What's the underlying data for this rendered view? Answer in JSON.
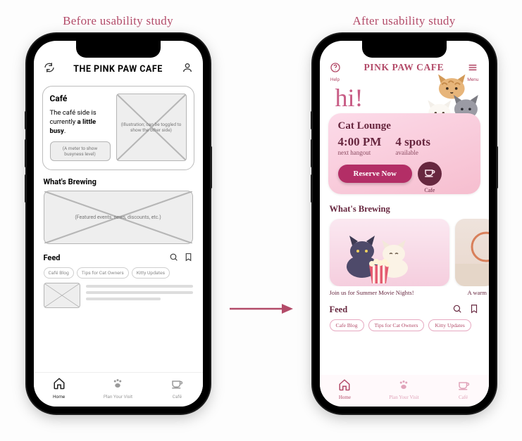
{
  "captions": {
    "before": "Before usability study",
    "after": "After usability study"
  },
  "before": {
    "title": "THE PINK PAW CAFE",
    "card": {
      "heading": "Café",
      "status_prefix": "The café side is currently ",
      "status_bold": "a little busy",
      "status_suffix": ".",
      "meter_placeholder": "(A meter to show busyness level)",
      "illustration_placeholder": "(Illustration; can be toggled to show the other side)"
    },
    "brewing": {
      "heading": "What's Brewing",
      "placeholder": "(Featured events, news, discounts, etc.)"
    },
    "feed": {
      "heading": "Feed",
      "chips": [
        "Café Blog",
        "Tips for Cat Owners",
        "Kitty Updates"
      ]
    },
    "nav": {
      "items": [
        {
          "label": "Home",
          "icon": "home-icon"
        },
        {
          "label": "Plan Your Visit",
          "icon": "paw-icon"
        },
        {
          "label": "Café",
          "icon": "cup-icon"
        }
      ]
    }
  },
  "after": {
    "title": "PINK PAW CAFE",
    "topbar": {
      "help_label": "Help",
      "menu_label": "Menu"
    },
    "greeting": "hi!",
    "panel": {
      "heading": "Cat Lounge",
      "time_value": "4:00 PM",
      "time_label": "next hangout",
      "spots_value": "4 spots",
      "spots_label": "available",
      "cta": "Reserve Now",
      "badge_label": "Cafe"
    },
    "brewing": {
      "heading": "What's Brewing",
      "card1_caption": "Join us for Summer Movie Nights!",
      "card2_caption": "A warm"
    },
    "feed": {
      "heading": "Feed",
      "chips": [
        "Cafe Blog",
        "Tips for Cat Owners",
        "Kitty Updates"
      ]
    },
    "nav": {
      "items": [
        {
          "label": "Home",
          "icon": "home-icon"
        },
        {
          "label": "Plan Your Visit",
          "icon": "paw-icon"
        },
        {
          "label": "Café",
          "icon": "cup-icon"
        }
      ]
    }
  }
}
